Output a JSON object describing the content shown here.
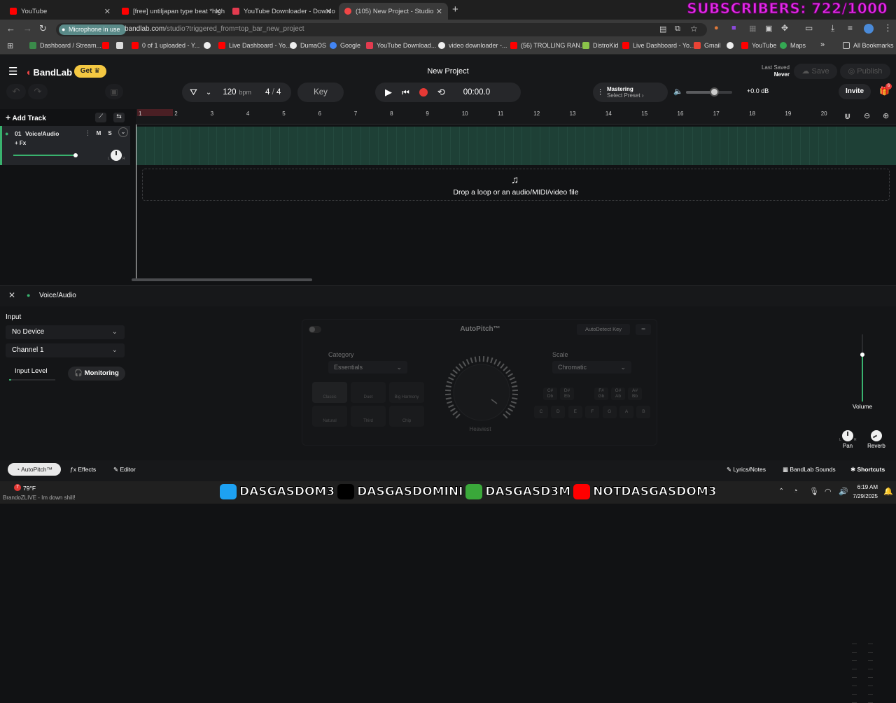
{
  "browser": {
    "tabs": [
      {
        "title": "YouTube",
        "color": "#ff0000"
      },
      {
        "title": "[free] untiljapan type beat *high",
        "color": "#ff0000"
      },
      {
        "title": "YouTube Downloader - Downlo",
        "color": "#e23b4f"
      },
      {
        "title": "(105) New Project - Studio",
        "color": "#f04646"
      }
    ],
    "new_tab": "+",
    "overlay_text": "SUBSCRIBERS: 722/1000",
    "mic_pill": "Microphone in use",
    "url_host": "bandlab.com",
    "url_path": "/studio?triggered_from=top_bar_new_project",
    "bookmarks": [
      "Dashboard / Stream...",
      "",
      "0 of 1 uploaded - Y...",
      "",
      "Live Dashboard - Yo...",
      "DumaOS",
      "Google",
      "YouTube Download...",
      "video downloader -...",
      "(56) TROLLING RAN...",
      "DistroKid",
      "Live Dashboard - Yo...",
      "Gmail",
      "",
      "YouTube",
      "Maps"
    ],
    "more_bookmarks": "»",
    "all_bookmarks": "All Bookmarks"
  },
  "header": {
    "brand": "BandLab",
    "get_label": "Get",
    "project_title": "New Project",
    "last_saved_label": "Last Saved",
    "last_saved_value": "Never",
    "save_label": "Save",
    "publish_label": "Publish"
  },
  "transport": {
    "bpm_value": "120",
    "bpm_unit": "bpm",
    "time_sig_top": "4",
    "time_sig_sep": "/",
    "time_sig_bottom": "4",
    "key_label": "Key",
    "time": "00:00.0",
    "mastering_title": "Mastering",
    "mastering_sub": "Select Preset",
    "volume_db": "+0.0 dB",
    "invite_label": "Invite",
    "gift_badge": "6",
    "master_volume": 0.6
  },
  "tracks": {
    "add_track_label": "Add Track",
    "items": [
      {
        "number": "01",
        "name": "Voice/Audio",
        "mute": "M",
        "solo": "S",
        "fx": "+ Fx",
        "volume": 0.7,
        "pan_left": "L",
        "pan_right": "R"
      }
    ]
  },
  "ruler": {
    "bars": [
      "1",
      "2",
      "3",
      "4",
      "5",
      "6",
      "7",
      "8",
      "9",
      "10",
      "11",
      "12",
      "13",
      "14",
      "15",
      "16",
      "17",
      "18",
      "19",
      "20"
    ]
  },
  "drop_zone": {
    "text": "Drop a loop or an audio/MIDI/video file"
  },
  "editor": {
    "track_name": "Voice/Audio",
    "input_title": "Input",
    "device": "No Device",
    "channel": "Channel 1",
    "input_level_label": "Input Level",
    "monitoring_label": "Monitoring",
    "autopitch": {
      "title": "AutoPitch™",
      "autodetect_label": "AutoDetect Key",
      "category_label": "Category",
      "category_value": "Essentials",
      "scale_label": "Scale",
      "scale_value": "Chromatic",
      "effects": [
        "Classic",
        "Duet",
        "Big Harmony",
        "Natural",
        "Third",
        "Chip"
      ],
      "knob_label": "Heaviest",
      "sharp_keys": [
        "C#\nDb",
        "D#\nEb",
        "F#\nGb",
        "G#\nAb",
        "A#\nBb"
      ],
      "natural_keys": [
        "C",
        "D",
        "E",
        "F",
        "G",
        "A",
        "B"
      ]
    },
    "volume_label": "Volume",
    "pan_label": "Pan",
    "reverb_label": "Reverb",
    "pan_l": "L",
    "pan_r": "R",
    "channel_volume": 0.7
  },
  "bottom_tabs": {
    "autopitch": "AutoPitch™",
    "effects": "Effects",
    "editor": "Editor",
    "lyrics": "Lyrics/Notes",
    "sounds": "BandLab Sounds",
    "shortcuts": "Shortcuts"
  },
  "taskbar": {
    "weather": "79°F",
    "weather_badge": "7",
    "stream_text": "BrandoZLIVE - Im down shill!",
    "social": [
      "DASGASDOM3",
      "DASGASDOMINI",
      "DASGASD3M",
      "NOTDASGASDOM3"
    ],
    "time": "6:19 AM",
    "date": "7/29/2025"
  },
  "colors": {
    "accent_green": "#39b26e",
    "record_red": "#e53935",
    "brand_red": "#f04646",
    "get_yellow": "#f4c842",
    "overlay_magenta": "#e22be8"
  }
}
